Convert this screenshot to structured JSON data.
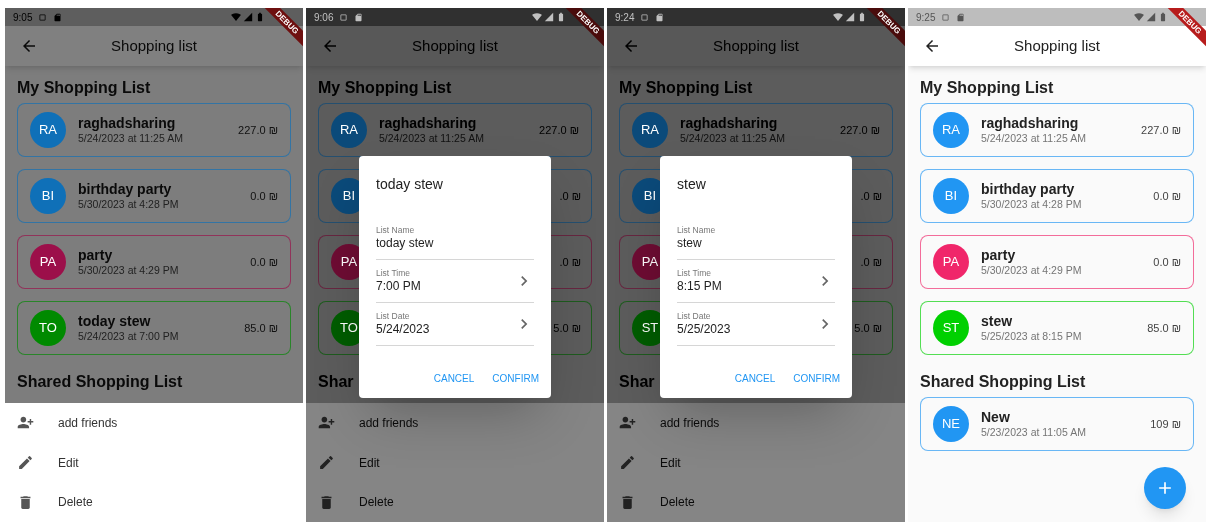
{
  "screens": [
    {
      "status_time": "9:05",
      "banner": "DEBUG",
      "title": "Shopping list",
      "sections": [
        {
          "title": "My Shopping List",
          "items": [
            {
              "kind": "full",
              "initials": "RA",
              "name": "raghadsharing",
              "time": "5/24/2023 at 11:25 AM",
              "amount": "227.0 ₪",
              "color": "#0f70b8"
            },
            {
              "kind": "full",
              "initials": "BI",
              "name": "birthday party",
              "time": "5/30/2023 at 4:28 PM",
              "amount": "0.0 ₪",
              "color": "#0f70b8"
            },
            {
              "kind": "full",
              "initials": "PA",
              "name": "party",
              "time": "5/30/2023 at 4:29 PM",
              "amount": "0.0 ₪",
              "color": "#9c0f4a"
            },
            {
              "kind": "full",
              "initials": "TO",
              "name": "today stew",
              "time": "5/24/2023 at 7:00 PM",
              "amount": "85.0 ₪",
              "color": "#008a00"
            }
          ]
        },
        {
          "title": "Shared Shopping List"
        }
      ],
      "sheet": {
        "items": [
          {
            "kind": "add-friends",
            "label": "add friends"
          },
          {
            "kind": "edit",
            "label": "Edit"
          },
          {
            "kind": "delete",
            "label": "Delete"
          }
        ]
      }
    },
    {
      "status_time": "9:06",
      "banner": "DEBUG",
      "title": "Shopping list",
      "sections": [
        {
          "title": "My Shopping List",
          "items": [
            {
              "kind": "full",
              "initials": "RA",
              "name": "raghadsharing",
              "time": "5/24/2023 at 11:25 AM",
              "amount": "227.0 ₪",
              "color": "#0b4a7a"
            },
            {
              "kind": "covered",
              "initials": "BI",
              "amount": ".0 ₪",
              "color": "#0b4a7a"
            },
            {
              "kind": "covered",
              "initials": "PA",
              "amount": ".0 ₪",
              "color": "#6e0c33"
            },
            {
              "kind": "covered",
              "initials": "TO",
              "amount": "5.0 ₪",
              "color": "#005c00"
            }
          ]
        },
        {
          "title": "Shar"
        }
      ],
      "sheet": {
        "items": [
          {
            "kind": "add-friends",
            "label": "add friends"
          },
          {
            "kind": "edit",
            "label": "Edit"
          },
          {
            "kind": "delete",
            "label": "Delete"
          }
        ]
      },
      "dialog": {
        "title": "today stew",
        "fields": [
          {
            "kind": "text",
            "label": "List Name",
            "value": "today stew"
          },
          {
            "kind": "picker",
            "label": "List Time",
            "value": "7:00 PM"
          },
          {
            "kind": "picker",
            "label": "List Date",
            "value": "5/24/2023"
          }
        ],
        "actions": [
          "CANCEL",
          "CONFIRM"
        ]
      }
    },
    {
      "status_time": "9:24",
      "banner": "DEBUG",
      "title": "Shopping list",
      "sections": [
        {
          "title": "My Shopping List",
          "items": [
            {
              "kind": "full",
              "initials": "RA",
              "name": "raghadsharing",
              "time": "5/24/2023 at 11:25 AM",
              "amount": "227.0 ₪",
              "color": "#0b4a7a"
            },
            {
              "kind": "covered",
              "initials": "BI",
              "amount": ".0 ₪",
              "color": "#0b4a7a"
            },
            {
              "kind": "covered",
              "initials": "PA",
              "amount": ".0 ₪",
              "color": "#6e0c33"
            },
            {
              "kind": "covered",
              "initials": "ST",
              "amount": "5.0 ₪",
              "color": "#005c00"
            }
          ]
        },
        {
          "title": "Shar"
        }
      ],
      "sheet": {
        "items": [
          {
            "kind": "add-friends",
            "label": "add friends"
          },
          {
            "kind": "edit",
            "label": "Edit"
          },
          {
            "kind": "delete",
            "label": "Delete"
          }
        ]
      },
      "dialog": {
        "title": "stew",
        "fields": [
          {
            "kind": "text",
            "label": "List Name",
            "value": "stew"
          },
          {
            "kind": "picker",
            "label": "List Time",
            "value": "8:15 PM"
          },
          {
            "kind": "picker",
            "label": "List Date",
            "value": "5/25/2023"
          }
        ],
        "actions": [
          "CANCEL",
          "CONFIRM"
        ]
      }
    },
    {
      "status_time": "9:25",
      "banner": "DEBUG",
      "title": "Shopping list",
      "sections": [
        {
          "title": "My Shopping List",
          "items": [
            {
              "kind": "full",
              "initials": "RA",
              "name": "raghadsharing",
              "time": "5/24/2023 at 11:25 AM",
              "amount": "227.0 ₪",
              "color": "#2196f3"
            },
            {
              "kind": "full",
              "initials": "BI",
              "name": "birthday party",
              "time": "5/30/2023 at 4:28 PM",
              "amount": "0.0 ₪",
              "color": "#2196f3"
            },
            {
              "kind": "full",
              "initials": "PA",
              "name": "party",
              "time": "5/30/2023 at 4:29 PM",
              "amount": "0.0 ₪",
              "color": "#f0266a"
            },
            {
              "kind": "full",
              "initials": "ST",
              "name": "stew",
              "time": "5/25/2023 at 8:15 PM",
              "amount": "85.0 ₪",
              "color": "#00d000"
            }
          ]
        },
        {
          "title": "Shared Shopping List",
          "items": [
            {
              "kind": "full",
              "initials": "NE",
              "name": "New",
              "time": "5/23/2023 at 11:05 AM",
              "amount": "109 ₪",
              "color": "#2196f3"
            }
          ]
        }
      ],
      "fab": true
    }
  ]
}
